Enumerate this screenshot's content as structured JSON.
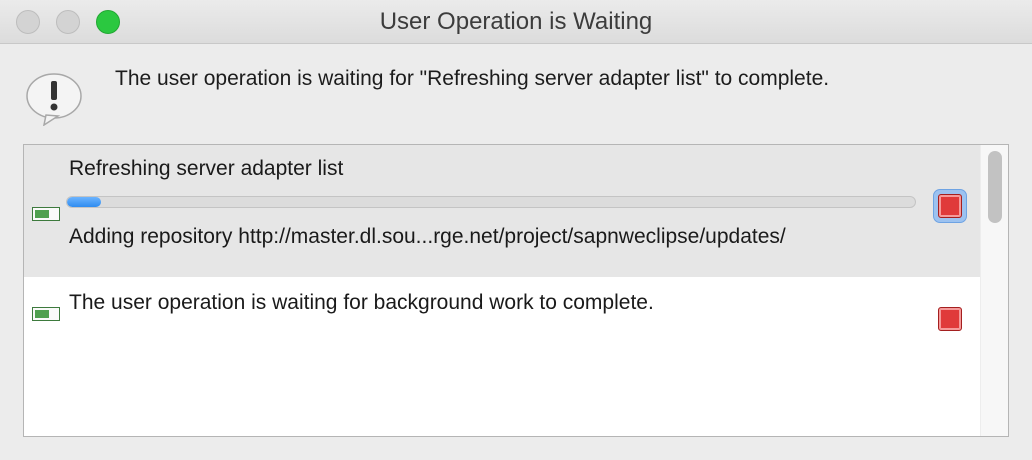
{
  "window": {
    "title": "User Operation is Waiting"
  },
  "dialog": {
    "message": "The user operation is waiting for \"Refreshing server adapter list\" to complete.",
    "icon": "warning-speech-bubble-icon"
  },
  "jobs": [
    {
      "name": "Refreshing server adapter list",
      "progress": 0.04,
      "detail": "Adding repository http://master.dl.sou...rge.net/project/sapnweclipse/updates/",
      "icon": "progress-job-icon",
      "stop_icon": "stop-icon"
    },
    {
      "name": "The user operation is waiting for background work to complete.",
      "icon": "progress-job-icon",
      "stop_icon": "stop-icon"
    }
  ],
  "colors": {
    "progress_fill": "#2f8cf0",
    "stop_button": "#e03a3a",
    "zoom_button": "#2bc840",
    "selected_row": "#e6e6e6"
  }
}
